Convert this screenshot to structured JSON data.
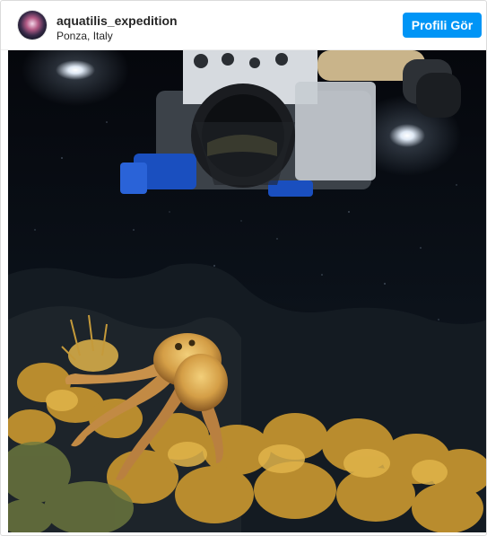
{
  "post": {
    "username": "aquatilis_expedition",
    "location": "Ponza, Italy",
    "profile_button_label": "Profili Gör",
    "avatar_icon": "avatar-icon",
    "photo_icon": "underwater-octopus-photo"
  },
  "colors": {
    "accent": "#0095f6",
    "text": "#262626",
    "border": "#dbdbdb"
  }
}
